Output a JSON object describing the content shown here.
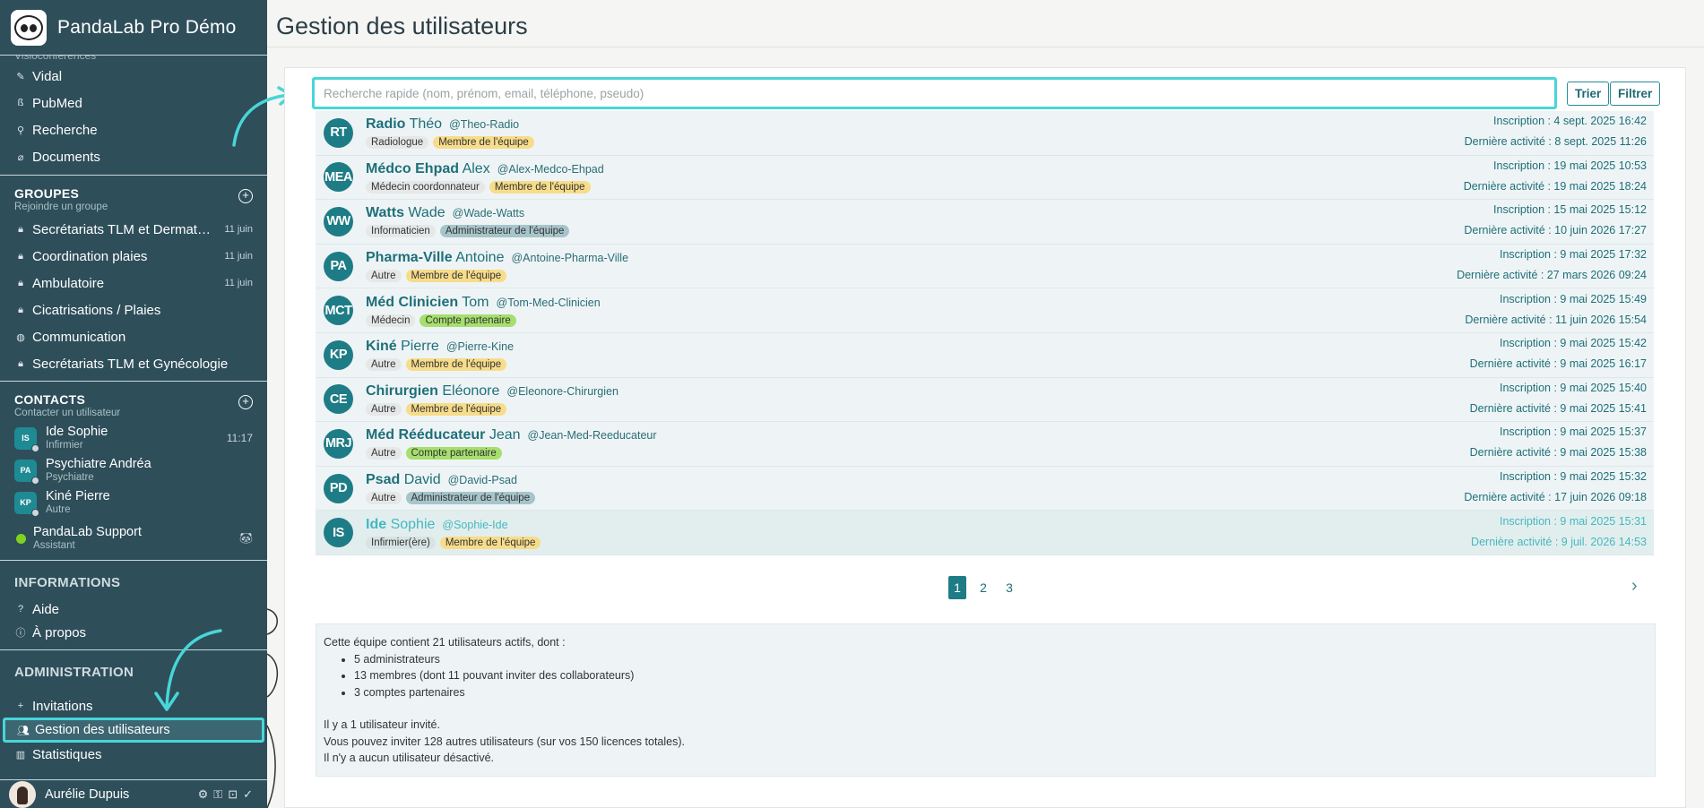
{
  "app": {
    "name": "PandaLab Pro Démo",
    "cut_item": "Visioconférences"
  },
  "sidebar": {
    "top_items": [
      {
        "label": "Vidal",
        "icon": "pill-icon"
      },
      {
        "label": "PubMed",
        "icon": "pubmed-icon"
      },
      {
        "label": "Recherche",
        "icon": "search-icon"
      },
      {
        "label": "Documents",
        "icon": "paperclip-icon"
      }
    ],
    "groups": {
      "title": "GROUPES",
      "subtitle": "Rejoindre un groupe",
      "items": [
        {
          "label": "Secrétariats TLM et Dermatol...",
          "meta": "11 juin"
        },
        {
          "label": "Coordination plaies",
          "meta": "11 juin"
        },
        {
          "label": "Ambulatoire",
          "meta": "11 juin"
        },
        {
          "label": "Cicatrisations / Plaies",
          "meta": ""
        },
        {
          "label": "Communication",
          "meta": ""
        },
        {
          "label": "Secrétariats TLM et Gynécologie",
          "meta": ""
        }
      ]
    },
    "contacts": {
      "title": "CONTACTS",
      "subtitle": "Contacter un utilisateur",
      "items": [
        {
          "initials": "IS",
          "name": "Ide Sophie",
          "role": "Infirmier",
          "time": "11:17"
        },
        {
          "initials": "PA",
          "name": "Psychiatre Andréa",
          "role": "Psychiatre",
          "time": ""
        },
        {
          "initials": "KP",
          "name": "Kiné Pierre",
          "role": "Autre",
          "time": ""
        }
      ],
      "support": {
        "name": "PandaLab Support",
        "role": "Assistant"
      }
    },
    "informations": {
      "title": "INFORMATIONS",
      "items": [
        {
          "label": "Aide",
          "icon": "?"
        },
        {
          "label": "À propos",
          "icon": "ⓘ"
        }
      ]
    },
    "administration": {
      "title": "ADMINISTRATION",
      "items": [
        {
          "label": "Invitations",
          "icon": "+"
        },
        {
          "label": "Gestion des utilisateurs",
          "icon": "users-icon"
        },
        {
          "label": "Statistiques",
          "icon": "chart-icon"
        }
      ]
    },
    "me": {
      "name": "Aurélie Dupuis"
    }
  },
  "page": {
    "title": "Gestion des utilisateurs"
  },
  "search": {
    "placeholder": "Recherche rapide (nom, prénom, email, téléphone, pseudo)"
  },
  "buttons": {
    "sort": "Trier",
    "filter": "Filtrer"
  },
  "users": [
    {
      "initials": "RT",
      "last": "Radio",
      "first": "Théo",
      "pseudo": "@Theo-Radio",
      "profession": "Radiologue",
      "role": "Membre de l'équipe",
      "role_type": "member",
      "inscription": "Inscription : 4 sept. 2025 16:42",
      "activity": "Dernière activité : 8 sept. 2025 11:26"
    },
    {
      "initials": "MEA",
      "last": "Médco Ehpad",
      "first": "Alex",
      "pseudo": "@Alex-Medco-Ehpad",
      "profession": "Médecin coordonnateur",
      "role": "Membre de l'équipe",
      "role_type": "member",
      "inscription": "Inscription : 19 mai 2025 10:53",
      "activity": "Dernière activité : 19 mai 2025 18:24"
    },
    {
      "initials": "WW",
      "last": "Watts",
      "first": "Wade",
      "pseudo": "@Wade-Watts",
      "profession": "Informaticien",
      "role": "Administrateur de l'équipe",
      "role_type": "admin",
      "inscription": "Inscription : 15 mai 2025 15:12",
      "activity": "Dernière activité : 10 juin 2026 17:27"
    },
    {
      "initials": "PA",
      "last": "Pharma-Ville",
      "first": "Antoine",
      "pseudo": "@Antoine-Pharma-Ville",
      "profession": "Autre",
      "role": "Membre de l'équipe",
      "role_type": "member",
      "inscription": "Inscription : 9 mai 2025 17:32",
      "activity": "Dernière activité : 27 mars 2026 09:24"
    },
    {
      "initials": "MCT",
      "last": "Méd Clinicien",
      "first": "Tom",
      "pseudo": "@Tom-Med-Clinicien",
      "profession": "Médecin",
      "role": "Compte partenaire",
      "role_type": "partner",
      "inscription": "Inscription : 9 mai 2025 15:49",
      "activity": "Dernière activité : 11 juin 2026 15:54"
    },
    {
      "initials": "KP",
      "last": "Kiné",
      "first": "Pierre",
      "pseudo": "@Pierre-Kine",
      "profession": "Autre",
      "role": "Membre de l'équipe",
      "role_type": "member",
      "inscription": "Inscription : 9 mai 2025 15:42",
      "activity": "Dernière activité : 9 mai 2025 16:17"
    },
    {
      "initials": "CE",
      "last": "Chirurgien",
      "first": "Eléonore",
      "pseudo": "@Eleonore-Chirurgien",
      "profession": "Autre",
      "role": "Membre de l'équipe",
      "role_type": "member",
      "inscription": "Inscription : 9 mai 2025 15:40",
      "activity": "Dernière activité : 9 mai 2025 15:41"
    },
    {
      "initials": "MRJ",
      "last": "Méd Rééducateur",
      "first": "Jean",
      "pseudo": "@Jean-Med-Reeducateur",
      "profession": "Autre",
      "role": "Compte partenaire",
      "role_type": "partner",
      "inscription": "Inscription : 9 mai 2025 15:37",
      "activity": "Dernière activité : 9 mai 2025 15:38"
    },
    {
      "initials": "PD",
      "last": "Psad",
      "first": "David",
      "pseudo": "@David-Psad",
      "profession": "Autre",
      "role": "Administrateur de l'équipe",
      "role_type": "admin",
      "inscription": "Inscription : 9 mai 2025 15:32",
      "activity": "Dernière activité : 17 juin 2026 09:18"
    },
    {
      "initials": "IS",
      "last": "Ide",
      "first": "Sophie",
      "pseudo": "@Sophie-Ide",
      "profession": "Infirmier(ère)",
      "role": "Membre de l'équipe",
      "role_type": "member",
      "inscription": "Inscription : 9 mai 2025 15:31",
      "activity": "Dernière activité : 9 juil. 2026 14:53",
      "selected": true
    }
  ],
  "pagination": {
    "pages": [
      "1",
      "2",
      "3"
    ],
    "current": "1",
    "next": "›"
  },
  "summary": {
    "intro": "Cette équipe contient 21 utilisateurs actifs, dont :",
    "bullets": [
      "5 administrateurs",
      "13 membres (dont 11 pouvant inviter des collaborateurs)",
      "3 comptes partenaires"
    ],
    "lines": [
      "Il y a 1 utilisateur invité.",
      "Vous pouvez inviter 128 autres utilisateurs (sur vos 150 licences totales).",
      "Il n'y a aucun utilisateur désactivé."
    ]
  },
  "colors": {
    "accent": "#48d6d8",
    "sidebar": "#2e4e5a",
    "teal": "#1e7c86"
  }
}
